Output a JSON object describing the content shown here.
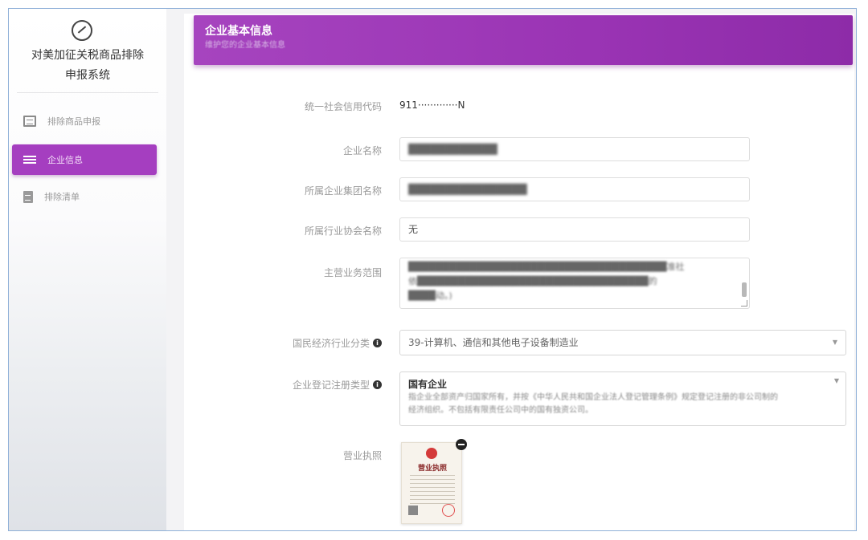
{
  "sidebar": {
    "app_title_line1": "对美加征关税商品排除",
    "app_title_line2": "申报系统",
    "items": [
      {
        "label": "排除商品申报",
        "icon": "list-icon",
        "active": false
      },
      {
        "label": "企业信息",
        "icon": "sliders-icon",
        "active": true
      },
      {
        "label": "排除清单",
        "icon": "document-icon",
        "active": false
      }
    ]
  },
  "card": {
    "title": "企业基本信息",
    "subtitle": "维护您的企业基本信息"
  },
  "form": {
    "credit_code": {
      "label": "统一社会信用代码",
      "value": "911·············N"
    },
    "company_name": {
      "label": "企业名称",
      "value": "████████████"
    },
    "group_name": {
      "label": "所属企业集团名称",
      "value": "████████████████"
    },
    "association": {
      "label": "所属行业协会名称",
      "value": "无"
    },
    "business_scope": {
      "label": "主营业务范围",
      "line1": "██████████████████████████████████████准社",
      "line2": "依██████████████████████████████████的",
      "line3": "████动。)"
    },
    "industry": {
      "label": "国民经济行业分类",
      "value": "39-计算机、通信和其他电子设备制造业"
    },
    "registration_type": {
      "label": "企业登记注册类型",
      "title": "国有企业",
      "desc_line1": "指企业全部资产归国家所有，并按《中华人民共和国企业法人登记管理条例》规定登记注册的非公司制的",
      "desc_line2": "经济组织。不包括有限责任公司中的国有独资公司。"
    },
    "license": {
      "label": "营业执照",
      "doc_title": "营业执照"
    }
  }
}
